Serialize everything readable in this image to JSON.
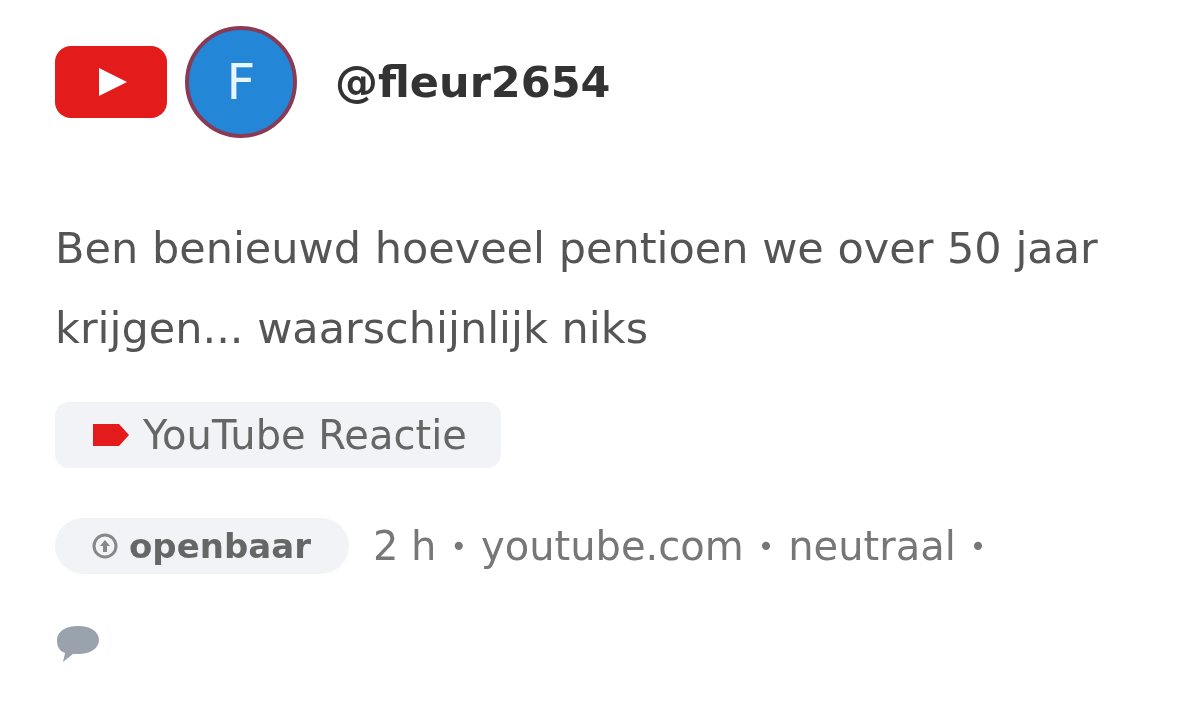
{
  "post": {
    "avatar_letter": "F",
    "username": "@fleur2654",
    "text": "Ben benieuwd hoeveel pentioen we over 50 jaar krijgen... waarschijnlijk niks",
    "tag": "YouTube Reactie",
    "visibility": "openbaar",
    "meta": [
      "2 h",
      "•",
      "youtube.com",
      "•",
      "neutraal",
      "•"
    ]
  }
}
